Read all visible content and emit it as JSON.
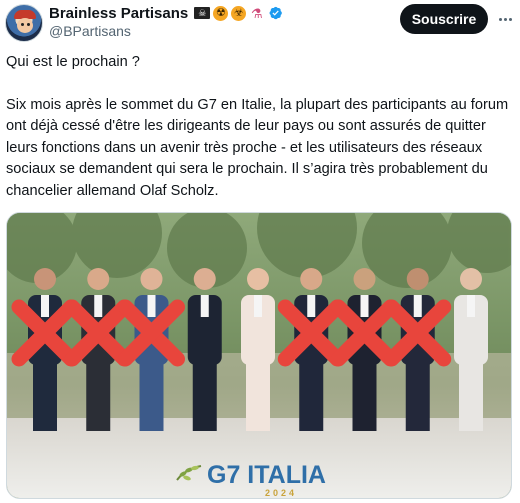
{
  "author": {
    "display_name": "Brainless Partisans",
    "handle": "@BPartisans",
    "emojis": [
      "pirate-flag-icon",
      "radioactive-icon",
      "biohazard-icon",
      "flask-icon"
    ],
    "verified": true
  },
  "actions": {
    "subscribe_label": "Souscrire"
  },
  "tweet": {
    "paragraph1": "Qui est le prochain ?",
    "paragraph2": "Six mois après le sommet du G7 en Italie, la plupart des participants au forum ont déjà cessé d'être les dirigeants de leur pays ou sont assurés de quitter leurs fonctions dans un avenir très proche - et les utilisateurs des réseaux sociaux se demandent qui sera le prochain. Il s’agira très probablement du chancelier allemand Olaf Scholz."
  },
  "media": {
    "banner_text": "G7 ITALIA",
    "banner_year": "2024",
    "people_count": 9,
    "crossed_out": [
      1,
      2,
      3,
      6,
      7,
      8
    ],
    "colors": {
      "cross": "#e8453c",
      "banner_text": "#2f6fa8",
      "banner_year": "#c9a33b"
    }
  }
}
